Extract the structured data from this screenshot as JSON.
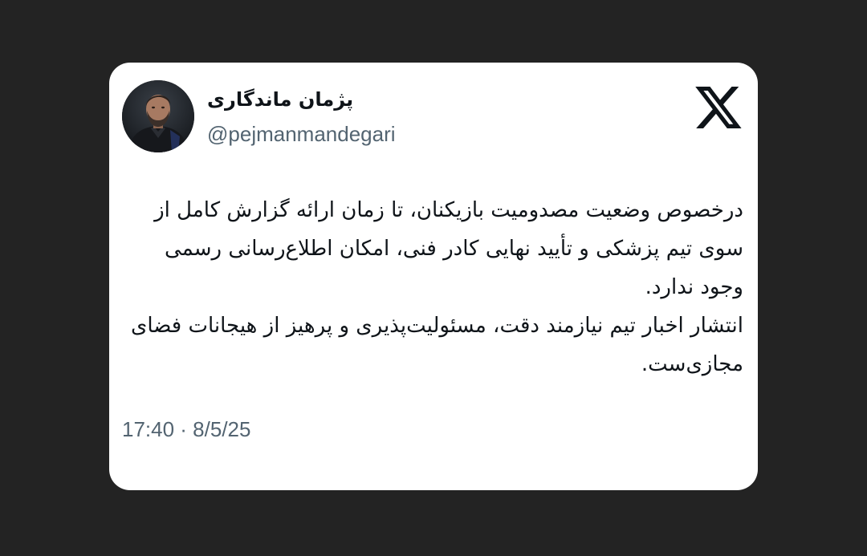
{
  "tweet": {
    "display_name": "پژمان ماندگاری",
    "handle": "@pejmanmandegari",
    "paragraphs": [
      "درخصوص وضعیت مصدومیت بازیکنان، تا زمان ارائه گزارش کامل از سوی تیم پزشکی و تأیید نهایی کادر فنی، امکان اطلاع‌رسانی رسمی وجود ندارد.",
      "انتشار اخبار تیم نیازمند دقت، مسئولیت‌پذیری و پرهیز از هیجانات فضای مجازی‌ست."
    ],
    "timestamp": "17:40 · 8/5/25"
  },
  "icons": {
    "brand_logo": "x-logo-icon",
    "avatar": "profile-photo"
  },
  "colors": {
    "background": "#232323",
    "card": "#ffffff",
    "text_primary": "#0f1419",
    "text_secondary": "#536471"
  }
}
